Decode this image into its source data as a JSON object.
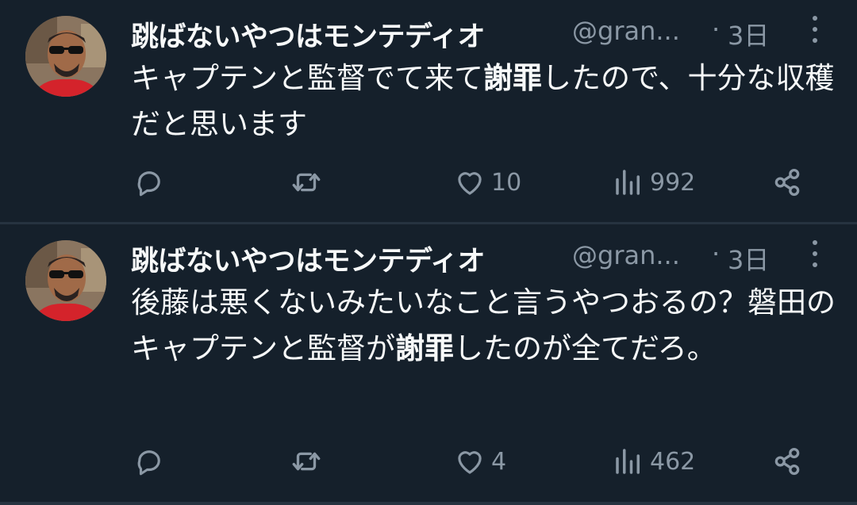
{
  "tweets": [
    {
      "display_name": "跳ばないやつはモンテディオ",
      "handle": "@gran...",
      "separator": "·",
      "time": "3日",
      "text_before": "キャプテンと監督でて来て",
      "text_bold": "謝罪",
      "text_after": "したので、十分な収穫だと思います",
      "replies": "",
      "retweets": "",
      "likes": "10",
      "views": "992",
      "icons": [
        "reply-icon",
        "retweet-icon",
        "like-icon",
        "views-icon",
        "share-icon",
        "more-icon"
      ]
    },
    {
      "display_name": "跳ばないやつはモンテディオ",
      "handle": "@gran...",
      "separator": "·",
      "time": "3日",
      "text_before": "後藤は悪くないみたいなこと言うやつおるの？磐田のキャプテンと監督が",
      "text_bold": "謝罪",
      "text_after": "したのが全てだろ。",
      "replies": "",
      "retweets": "",
      "likes": "4",
      "views": "462",
      "icons": [
        "reply-icon",
        "retweet-icon",
        "like-icon",
        "views-icon",
        "share-icon",
        "more-icon"
      ]
    }
  ],
  "colors": {
    "background": "#15202b",
    "text": "#f7f9f9",
    "secondary": "#8b98a5",
    "separator": "#263340"
  }
}
